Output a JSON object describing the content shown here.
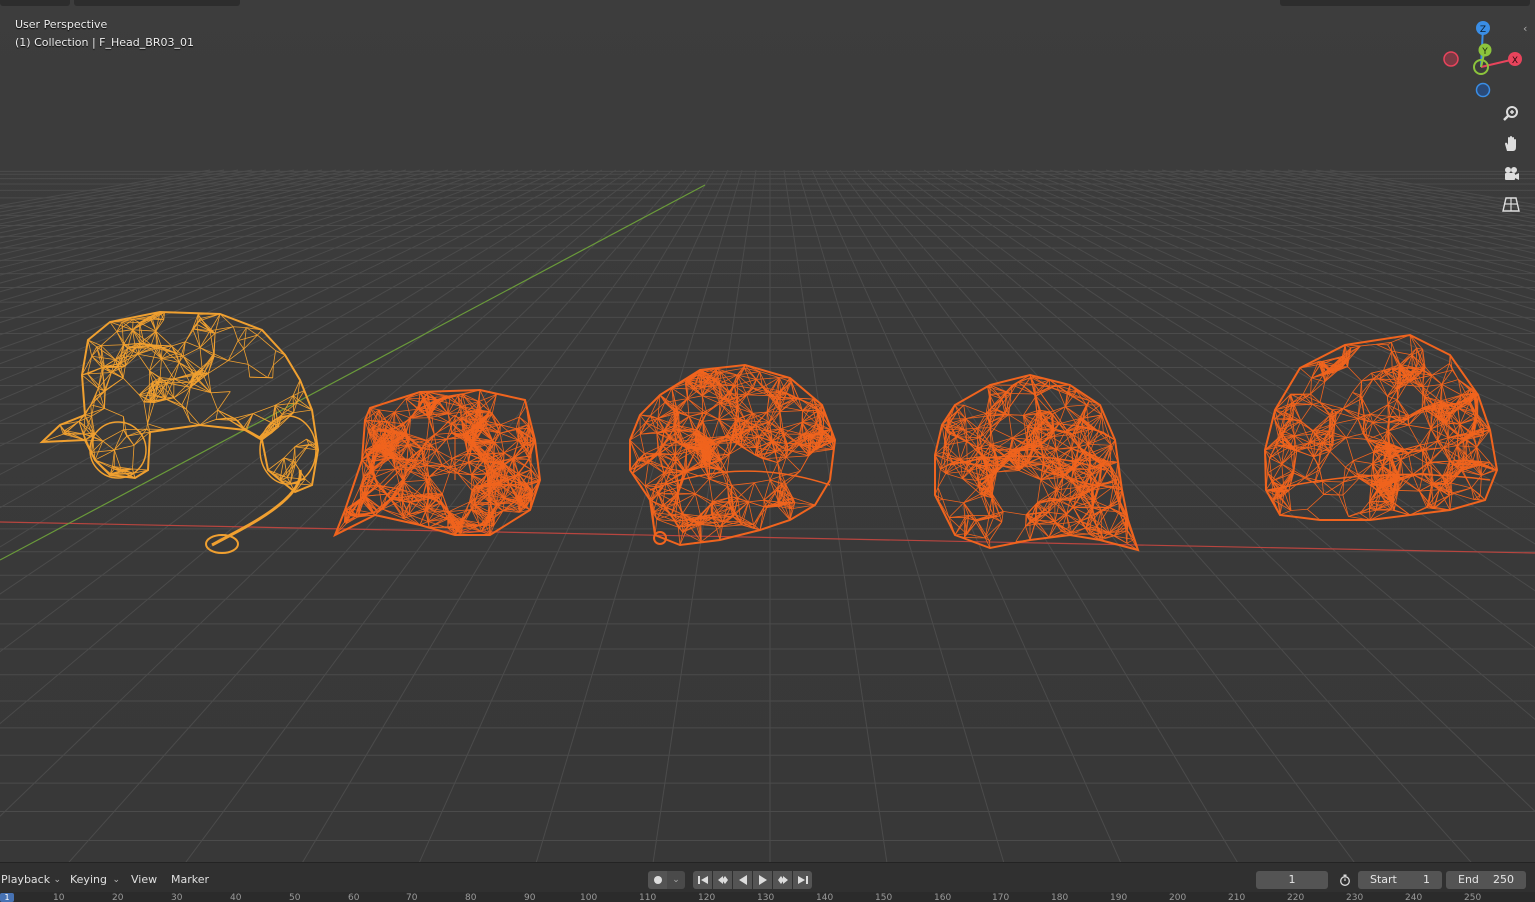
{
  "viewport": {
    "view_name": "User Perspective",
    "collection_info": "(1) Collection | F_Head_BR03_01",
    "objects": [
      {
        "name": "headset-cap-wireframe",
        "state": "selected-active"
      },
      {
        "name": "flat-cap-wireframe",
        "state": "selected"
      },
      {
        "name": "round-cap-wireframe",
        "state": "selected"
      },
      {
        "name": "baseball-cap-wireframe",
        "state": "selected"
      },
      {
        "name": "beanie-cap-wireframe",
        "state": "selected"
      }
    ],
    "colors": {
      "active_wire": "#f0a030",
      "selected_wire": "#f0641e",
      "x_axis": "#d04a4a",
      "y_axis": "#6a9a3a",
      "grid": "#4a4a4a"
    }
  },
  "gizmo": {
    "x_label": "X",
    "y_label": "Y",
    "z_label": "Z",
    "colors": {
      "x": "#e8445c",
      "y": "#8cc43c",
      "z": "#3a8ee6"
    }
  },
  "nav_icons": [
    "zoom-icon",
    "hand-pan-icon",
    "camera-icon",
    "grid-ortho-icon"
  ],
  "timeline": {
    "menus": {
      "playback": "Playback",
      "keying": "Keying",
      "view": "View",
      "marker": "Marker"
    },
    "current_frame": "1",
    "start_label": "Start",
    "start_value": "1",
    "end_label": "End",
    "end_value": "250",
    "ruler_ticks": [
      "10",
      "20",
      "30",
      "40",
      "50",
      "60",
      "70",
      "80",
      "90",
      "100",
      "110",
      "120",
      "130",
      "140",
      "150",
      "160",
      "170",
      "180",
      "190",
      "200",
      "210",
      "220",
      "230",
      "240",
      "250"
    ],
    "ruler_current": "1"
  }
}
